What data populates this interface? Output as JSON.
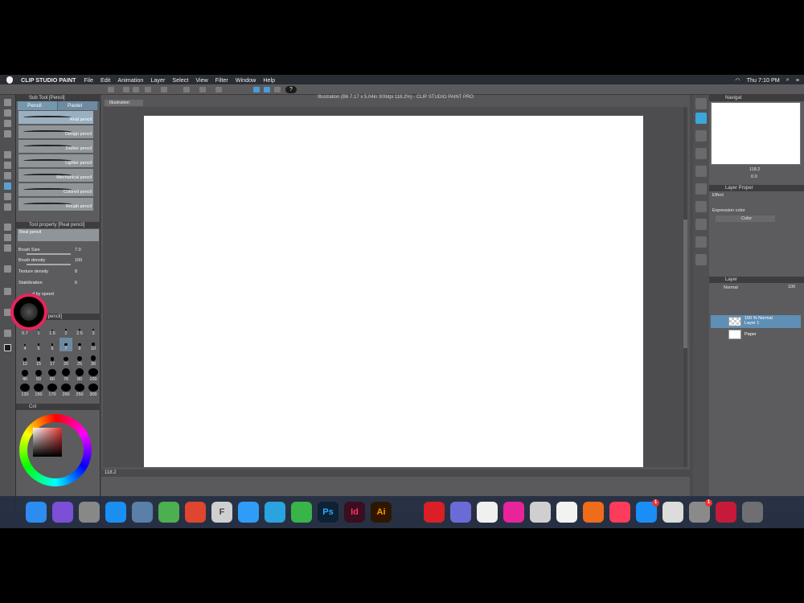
{
  "menubar": {
    "app": "CLIP STUDIO PAINT",
    "items": [
      "File",
      "Edit",
      "Animation",
      "Layer",
      "Select",
      "View",
      "Filter",
      "Window",
      "Help"
    ],
    "time": "Thu 7:10 PM"
  },
  "command_bar": {
    "help": "?"
  },
  "doc": {
    "title": "Illustration (B6 7.17 x 5.04in 300dpi 118.2%) - CLIP STUDIO PAINT PRO",
    "tab": "Illustration",
    "zoom": "118.2"
  },
  "subtool": {
    "header": "Sub Tool [Pencil]",
    "tabs": [
      "Pencil",
      "Pastel"
    ],
    "brushes": [
      "Real pencil",
      "Design pencil",
      "Darker pencil",
      "Lighter pencil",
      "Mechanical pencil",
      "Colored pencil",
      "Rough pencil"
    ]
  },
  "toolprop": {
    "header": "Tool property [Real pencil]",
    "preview_label": "Real pencil",
    "brush_size_label": "Brush Size",
    "brush_size": "7.0",
    "brush_density_label": "Brush density",
    "brush_density": "100",
    "texture_density_label": "Texture density",
    "texture_density": "8",
    "stabilization_label": "Stabilization",
    "stabilization": "6",
    "by_speed_label": "d by speed"
  },
  "brushsize": {
    "header": "ze [Real pencil]",
    "sizes": [
      "0.7",
      "1",
      "1.5",
      "2",
      "2.5",
      "3",
      "4",
      "5",
      "6",
      "7",
      "8",
      "10",
      "12",
      "15",
      "17",
      "20",
      "25",
      "30",
      "40",
      "50",
      "60",
      "70",
      "80",
      "100",
      "120",
      "150",
      "170",
      "200",
      "250",
      "300"
    ]
  },
  "color": {
    "header": "Col"
  },
  "navigator": {
    "header": "Navigat",
    "zoom": "118.2",
    "angle": "0.0"
  },
  "layerprop": {
    "header": "Layer Proper",
    "effect_label": "Effect",
    "expression_label": "Expression color",
    "expression_value": "Color"
  },
  "layers": {
    "header": "Layer",
    "blend": "Normal",
    "opacity": "100",
    "rows": [
      {
        "line1": "100 % Normal",
        "line2": "Layer 1",
        "selected": true
      },
      {
        "line1": "",
        "line2": "Paper",
        "selected": false
      }
    ]
  },
  "dock": {
    "apps": [
      {
        "name": "finder",
        "label": "",
        "color": "#2d8cf0"
      },
      {
        "name": "siri",
        "label": "",
        "color": "#7b4fd6"
      },
      {
        "name": "launchpad",
        "label": "",
        "color": "#888"
      },
      {
        "name": "safari",
        "label": "",
        "color": "#1b8ef2"
      },
      {
        "name": "preview",
        "label": "",
        "color": "#5a7fa8"
      },
      {
        "name": "maps",
        "label": "",
        "color": "#4caf50"
      },
      {
        "name": "wunderlist",
        "label": "",
        "color": "#e0452f"
      },
      {
        "name": "font-book",
        "label": "F",
        "color": "#cfcfcf"
      },
      {
        "name": "messages",
        "label": "",
        "color": "#2f9df7"
      },
      {
        "name": "telegram",
        "label": "",
        "color": "#2aa3df"
      },
      {
        "name": "facetime",
        "label": "",
        "color": "#38b449"
      },
      {
        "name": "photoshop",
        "label": "Ps",
        "color": "#0c2236"
      },
      {
        "name": "indesign",
        "label": "Id",
        "color": "#3a0d20"
      },
      {
        "name": "illustrator",
        "label": "Ai",
        "color": "#2f1600"
      },
      {
        "name": "pencil",
        "label": "",
        "color": "transparent"
      },
      {
        "name": "creative-cloud",
        "label": "",
        "color": "#da1f26"
      },
      {
        "name": "color-app",
        "label": "",
        "color": "#6b6bd8"
      },
      {
        "name": "clip-studio",
        "label": "",
        "color": "#f0f0f0"
      },
      {
        "name": "affinity-link",
        "label": "",
        "color": "#e8249a"
      },
      {
        "name": "spiral-app",
        "label": "",
        "color": "#cfcfcf"
      },
      {
        "name": "color-drop",
        "label": "",
        "color": "#f2f2f2"
      },
      {
        "name": "firefox-like",
        "label": "",
        "color": "#ef6c1a"
      },
      {
        "name": "music",
        "label": "",
        "color": "#fc3c5a"
      },
      {
        "name": "app-store",
        "label": "",
        "color": "#1a8ef5",
        "badge": "1"
      },
      {
        "name": "screenshot",
        "label": "",
        "color": "#dcdcdc"
      },
      {
        "name": "system-preferences",
        "label": "",
        "color": "#8a8a8a",
        "badge": "1"
      },
      {
        "name": "magnet",
        "label": "",
        "color": "#c61a3b"
      },
      {
        "name": "trash",
        "label": "",
        "color": "#6f6f73"
      }
    ]
  },
  "colors": {
    "accent": "#7497ad",
    "canvas": "#ffffff",
    "circle_ring": "#e8245b"
  }
}
